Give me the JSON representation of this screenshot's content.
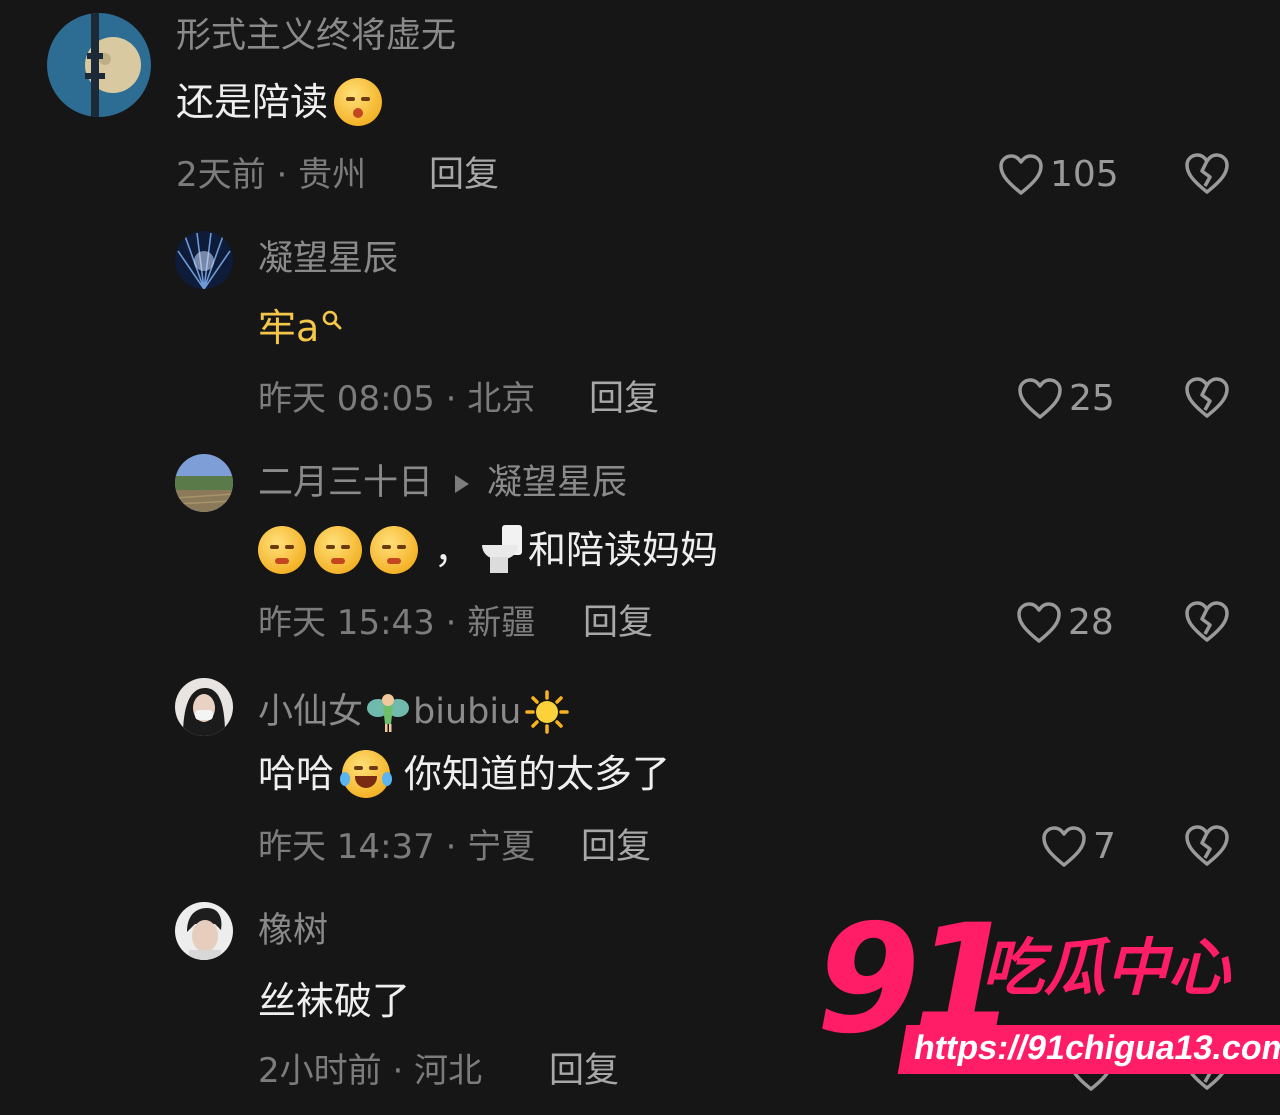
{
  "comments": [
    {
      "username": "形式主义终将虚无",
      "text": "还是陪读",
      "time": "2天前",
      "location": "贵州",
      "reply_label": "回复",
      "likes": "105"
    },
    {
      "username": "凝望星辰",
      "text": "牢a",
      "time": "昨天 08:05",
      "location": "北京",
      "reply_label": "回复",
      "likes": "25"
    },
    {
      "username": "二月三十日",
      "reply_to": "凝望星辰",
      "text_sep": "，",
      "text": "和陪读妈妈",
      "time": "昨天 15:43",
      "location": "新疆",
      "reply_label": "回复",
      "likes": "28"
    },
    {
      "username_a": "小仙女",
      "username_b": "biubiu",
      "text_a": "哈哈",
      "text_b": "你知道的太多了",
      "time": "昨天 14:37",
      "location": "宁夏",
      "reply_label": "回复",
      "likes": "7"
    },
    {
      "username": "橡树",
      "text": "丝袜破了",
      "time": "2小时前",
      "location": "河北",
      "reply_label": "回复"
    }
  ],
  "meta_sep": "·",
  "watermark": {
    "number": "91",
    "name": "吃瓜中心",
    "url": "https://91chigua13.com"
  },
  "icons": [
    "heart-outline-icon",
    "broken-heart-icon",
    "play-arrow-icon",
    "magnifier-icon"
  ],
  "colors": {
    "background": "#161616",
    "gold_text": "#f4c64a",
    "watermark": "#ff1d68"
  }
}
